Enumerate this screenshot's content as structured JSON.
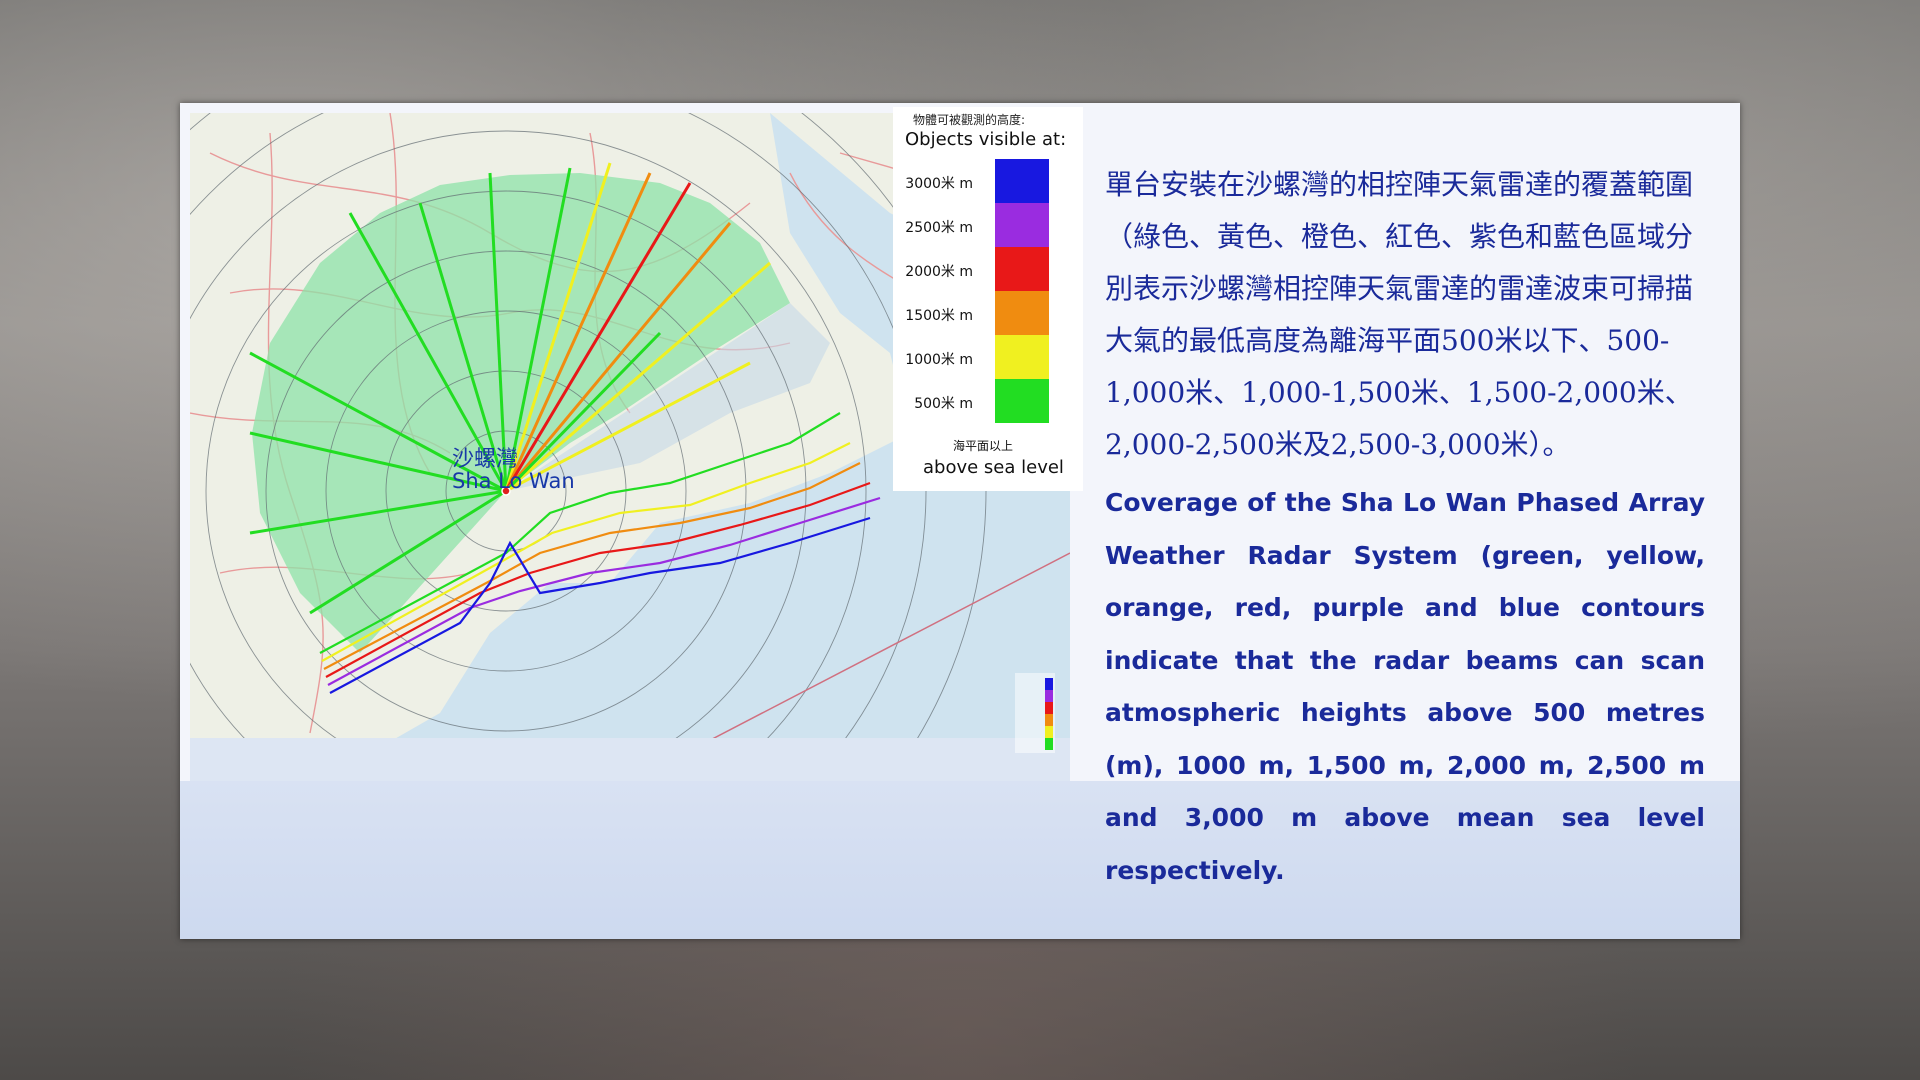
{
  "colors": {
    "green": "#22dd22",
    "yellow": "#f0f020",
    "orange": "#f08c10",
    "red": "#e81818",
    "purple": "#9a2ce0",
    "blue": "#1818e0",
    "text_blue": "#1a2a9a"
  },
  "map": {
    "radar_site_cn": "沙螺灣",
    "radar_site_en": "Sha Lo Wan"
  },
  "legend": {
    "title_cn": "物體可被觀測的高度:",
    "title_en": "Objects visible at:",
    "items": [
      {
        "label": "3000米 m",
        "color": "#1818e0"
      },
      {
        "label": "2500米 m",
        "color": "#9a2ce0"
      },
      {
        "label": "2000米 m",
        "color": "#e81818"
      },
      {
        "label": "1500米 m",
        "color": "#f08c10"
      },
      {
        "label": "1000米 m",
        "color": "#f0f020"
      },
      {
        "label": "500米 m",
        "color": "#22dd22"
      }
    ],
    "footer_cn": "海平面以上",
    "footer_en": "above sea level"
  },
  "description": {
    "chinese": "單台安裝在沙螺灣的相控陣天氣雷達的覆蓋範圍（綠色、黃色、橙色、紅色、紫色和藍色區域分別表示沙螺灣相控陣天氣雷達的雷達波束可掃描大氣的最低高度為離海平面500米以下、500-1,000米、1,000-1,500米、1,500-2,000米、2,000-2,500米及2,500-3,000米）。",
    "english": "Coverage of the Sha Lo Wan Phased Array Weather Radar System (green, yellow, orange, red, purple and blue contours indicate that the radar beams can scan atmospheric heights above 500 metres (m), 1000 m, 1,500 m, 2,000 m, 2,500 m and 3,000 m above mean sea level respectively."
  }
}
